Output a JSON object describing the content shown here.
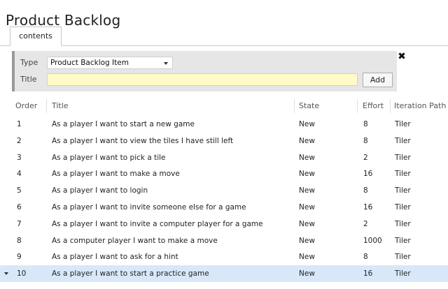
{
  "page": {
    "title": "Product Backlog"
  },
  "tabs": [
    {
      "label": "contents"
    }
  ],
  "add_panel": {
    "type_label": "Type",
    "type_value": "Product Backlog Item",
    "title_label": "Title",
    "title_value": "",
    "add_label": "Add",
    "close_glyph": "✖",
    "title_bg": "#fdfcc6"
  },
  "grid": {
    "columns": [
      "Order",
      "Title",
      "State",
      "Effort",
      "Iteration Path"
    ],
    "rows": [
      {
        "order": "1",
        "title": "As a player I want to start a new game",
        "state": "New",
        "effort": "8",
        "iteration": "Tiler"
      },
      {
        "order": "2",
        "title": "As a player I want to view the tiles I have still left",
        "state": "New",
        "effort": "8",
        "iteration": "Tiler"
      },
      {
        "order": "3",
        "title": "As a player I want to pick a tile",
        "state": "New",
        "effort": "2",
        "iteration": "Tiler"
      },
      {
        "order": "4",
        "title": "As a player I want to make a move",
        "state": "New",
        "effort": "16",
        "iteration": "Tiler"
      },
      {
        "order": "5",
        "title": "As a player I want to login",
        "state": "New",
        "effort": "8",
        "iteration": "Tiler"
      },
      {
        "order": "6",
        "title": "As a player I want to invite someone else for a game",
        "state": "New",
        "effort": "16",
        "iteration": "Tiler"
      },
      {
        "order": "7",
        "title": "As a player I want to invite a computer player for a game",
        "state": "New",
        "effort": "2",
        "iteration": "Tiler"
      },
      {
        "order": "8",
        "title": "As a computer player I want to make a move",
        "state": "New",
        "effort": "1000",
        "iteration": "Tiler"
      },
      {
        "order": "9",
        "title": "As a player I want to ask for a hint",
        "state": "New",
        "effort": "8",
        "iteration": "Tiler"
      },
      {
        "order": "10",
        "title": "As a player I want to start a practice game",
        "state": "New",
        "effort": "16",
        "iteration": "Tiler"
      }
    ],
    "selected_row_index": 9,
    "selected_color": "#d8e8f8"
  }
}
